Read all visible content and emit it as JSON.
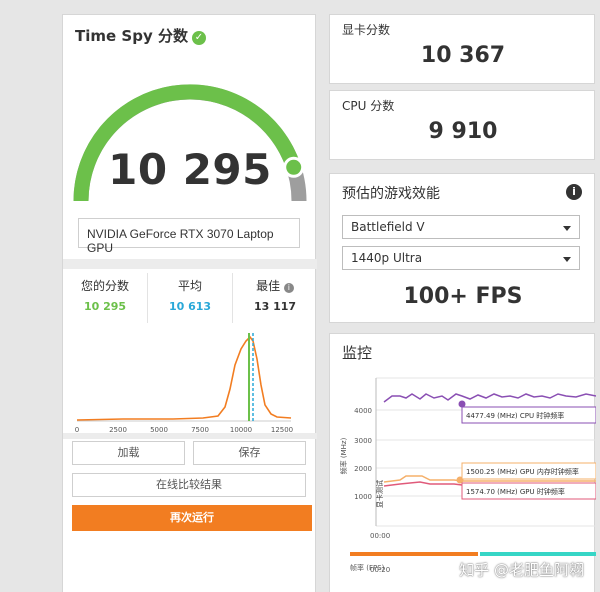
{
  "timespy": {
    "title": "Time Spy 分数",
    "score": "10 295",
    "gpu_name": "NVIDIA GeForce RTX 3070 Laptop GPU",
    "your_score_label": "您的分数",
    "your_score": "10 295",
    "average_label": "平均",
    "average": "10 613",
    "best_label": "最佳",
    "best": "13 117",
    "gauge_fraction": 0.9
  },
  "distribution": {
    "x_ticks": [
      "0",
      "2500",
      "5000",
      "7500",
      "10000",
      "12500"
    ]
  },
  "buttons": {
    "load": "加载",
    "save": "保存",
    "compare_online": "在线比较结果",
    "run_again": "再次运行"
  },
  "gpu_score": {
    "label": "显卡分数",
    "value": "10 367"
  },
  "cpu_score": {
    "label": "CPU 分数",
    "value": "9 910"
  },
  "estimated": {
    "title": "预估的游戏效能",
    "game": "Battlefield V",
    "preset": "1440p Ultra",
    "fps": "100+ FPS"
  },
  "monitor": {
    "title": "监控",
    "y_ticks": [
      "4000",
      "3000",
      "2000",
      "1000"
    ],
    "y_label": "频率 (MHz)",
    "test_label": "显卡测试",
    "x_ticks": [
      "00:00",
      "00:20"
    ],
    "cpu_clock": "4477.49 (MHz) CPU 时钟频率",
    "gpu_mem_clock": "1500.25 (MHz) GPU 内存时钟频率",
    "gpu_clock": "1574.70 (MHz) GPU 时钟频率",
    "fps_legend": "帧率 (FPS)"
  },
  "watermark": "知乎 @老肥鱼阿翱",
  "colors": {
    "green": "#6cc04a",
    "blue": "#29a8d8",
    "orange": "#f27d21",
    "purple": "#8a4fb3",
    "teal": "#36d6c6",
    "pink": "#e05a7a"
  }
}
